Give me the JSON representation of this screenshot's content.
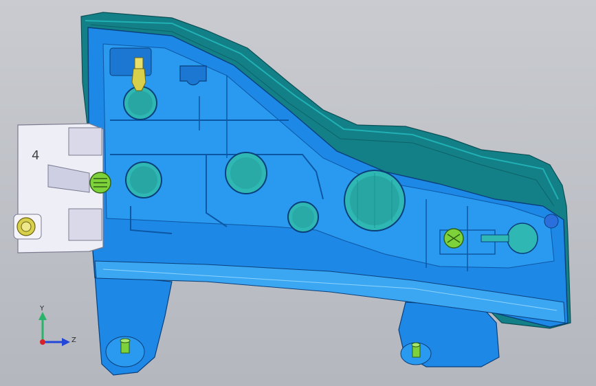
{
  "viewport": {
    "axis_labels": {
      "y": "Y",
      "z": "Z"
    },
    "connector_glyph": "4",
    "colors": {
      "background": "#c0c3c9",
      "part_fill": "#1e88e6",
      "part_fill_light": "#3ba7f2",
      "shell_teal": "#137f86",
      "shell_teal_light": "#1a9ca0",
      "cavity_teal": "#2fb7b3",
      "connector_white": "#eeeef6",
      "clip_yellow": "#d8cf4a",
      "clip_green": "#7dd13a",
      "axis_y": "#2bb36a",
      "axis_z": "#2346d8",
      "axis_x": "#d6232a"
    },
    "icons": {
      "triad": "axis-triad-icon",
      "bulb_socket": "bulb-socket-icon",
      "clip": "clip-icon",
      "pin": "locating-pin-icon"
    }
  }
}
